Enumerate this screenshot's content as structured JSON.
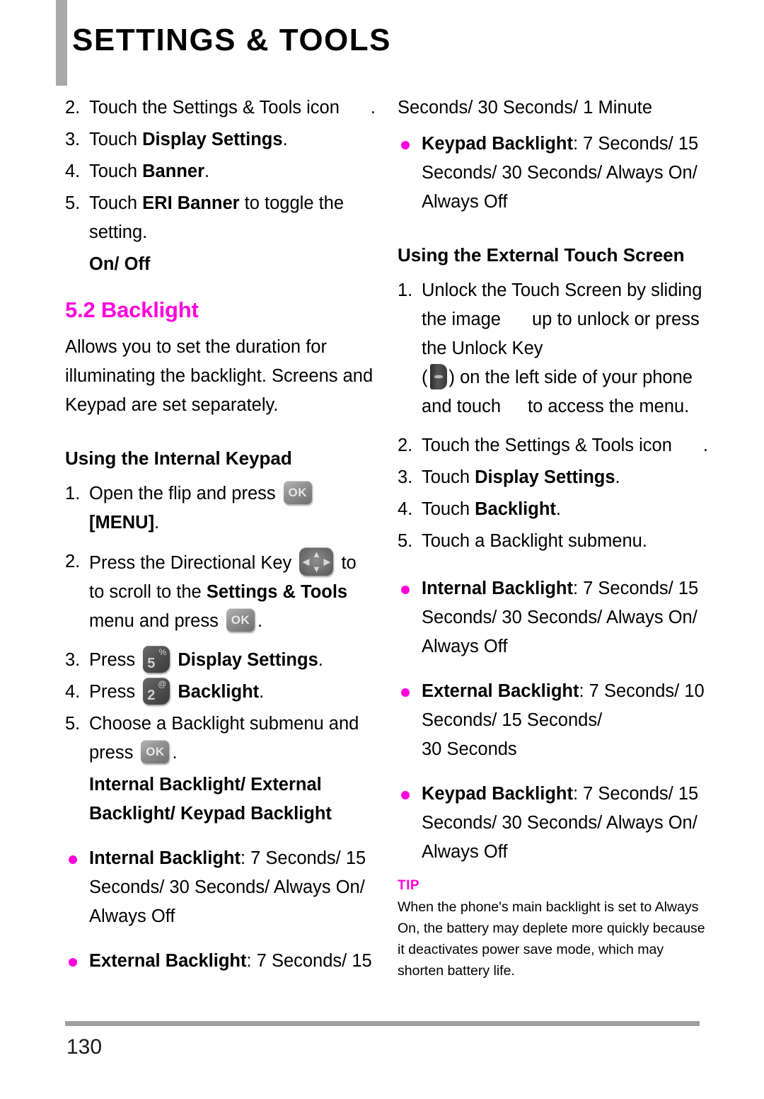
{
  "header": {
    "title": "SETTINGS & TOOLS"
  },
  "left_column": {
    "steps_top": [
      {
        "num": "2.",
        "text_before": "Touch the Settings & Tools icon",
        "icon": "settings-tools-icon",
        "text_after": "."
      },
      {
        "num": "3.",
        "plain": "Touch ",
        "bold": "Display Settings",
        "tail": "."
      },
      {
        "num": "4.",
        "plain": "Touch ",
        "bold": "Banner",
        "tail": "."
      },
      {
        "num": "5.",
        "plain": "Touch ",
        "bold": "ERI Banner",
        "tail": " to toggle the setting."
      }
    ],
    "on_off": "On/ Off",
    "section_heading": "5.2 Backlight",
    "intro_paragraph": "Allows you to set the duration for illuminating the backlight. Screens and Keypad are set separately.",
    "subheading_internal_keypad": "Using the Internal Keypad",
    "step1": {
      "num": "1.",
      "text_before": "Open the flip and press",
      "key": "OK",
      "bold_tail": "[MENU]",
      "tail_period": "."
    },
    "step2": {
      "num": "2.",
      "text_before": "Press the Directional Key",
      "key": "directional-key",
      "text_mid": "to scroll to the ",
      "bold": "Settings & Tools",
      "text_after": " menu and press",
      "key2": "OK",
      "tail": "."
    },
    "step3": {
      "num": "3.",
      "text_before": "Press",
      "key_digit": "5",
      "key_alt": "%",
      "bold": "Display Settings",
      "tail": "."
    },
    "step4": {
      "num": "4.",
      "text_before": "Press",
      "key_digit": "2",
      "key_alt": "@",
      "bold": "Backlight",
      "tail": "."
    },
    "step5": {
      "num": "5.",
      "text_before": "Choose a Backlight submenu and press",
      "key": "OK",
      "tail": "."
    },
    "submenu_options": "Internal Backlight/ External Backlight/ Keypad Backlight",
    "bullets": [
      {
        "label": "Internal Backlight",
        "sep": ": ",
        "values": "7 Seconds/ 15 Seconds/ 30 Seconds/ Always On/ Always Off"
      },
      {
        "label": "External Backlight",
        "sep": ": ",
        "values": "7 Seconds/ 15"
      }
    ]
  },
  "right_column": {
    "continued_line": "Seconds/ 30 Seconds/ 1 Minute",
    "bullet_keypad_top": {
      "label": "Keypad Backlight",
      "sep": ": ",
      "values": "7 Seconds/ 15 Seconds/ 30 Seconds/ Always On/ Always Off"
    },
    "subheading_external_touch": "Using the External Touch Screen",
    "step1": {
      "num": "1.",
      "part1": "Unlock the Touch Screen by sliding the image",
      "part2": "up to unlock or press the Unlock Key",
      "part3": "(",
      "part4": ") on the left side of your phone and touch",
      "part5": "to access the menu."
    },
    "steps": [
      {
        "num": "2.",
        "text_before": "Touch the Settings & Tools icon",
        "icon": "settings-tools-icon",
        "text_after": "."
      },
      {
        "num": "3.",
        "plain": "Touch ",
        "bold": "Display Settings",
        "tail": "."
      },
      {
        "num": "4.",
        "plain": "Touch ",
        "bold": "Backlight",
        "tail": "."
      },
      {
        "num": "5.",
        "plain": "Touch a Backlight submenu.",
        "bold": "",
        "tail": ""
      }
    ],
    "bullets": [
      {
        "label": "Internal Backlight",
        "sep": ": ",
        "values": "7 Seconds/ 15 Seconds/ 30 Seconds/ Always On/ Always Off"
      },
      {
        "label": "External Backlight",
        "sep": ": ",
        "values": "7 Seconds/ 10 Seconds/ 15 Seconds/",
        "values2": "30 Seconds"
      },
      {
        "label": "Keypad Backlight",
        "sep": ": ",
        "values": "7 Seconds/ 15 Seconds/ 30 Seconds/ Always On/ Always Off"
      }
    ],
    "tip": {
      "label": "TIP",
      "body": "When the phone's main backlight is set to Always On, the battery may deplete more quickly because it deactivates power save mode, which may shorten battery life."
    }
  },
  "footer": {
    "page_number": "130"
  },
  "colors": {
    "accent_magenta": "#ff00dc",
    "rule_gray": "#a0a0a0",
    "header_bar_gray": "#a8a8a8"
  }
}
